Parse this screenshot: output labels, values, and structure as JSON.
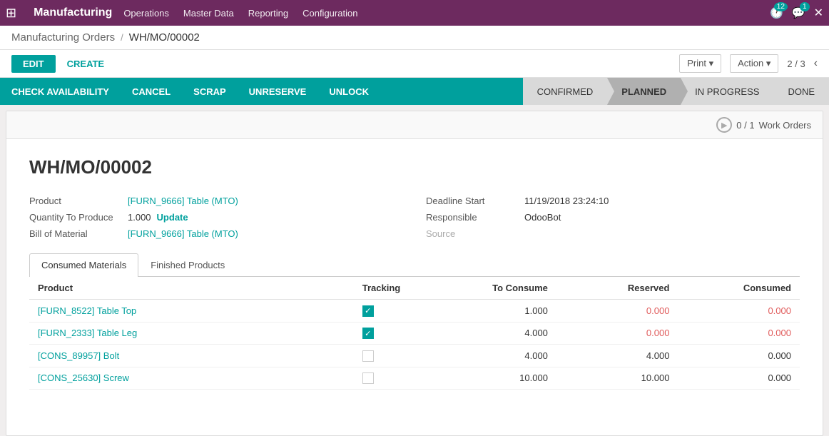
{
  "navbar": {
    "app_name": "Manufacturing",
    "menu_items": [
      "Operations",
      "Master Data",
      "Reporting",
      "Configuration"
    ],
    "notifications": {
      "calendar": "12",
      "chat": "1"
    }
  },
  "breadcrumb": {
    "parent": "Manufacturing Orders",
    "separator": "/",
    "current": "WH/MO/00002"
  },
  "action_bar": {
    "edit_label": "EDIT",
    "create_label": "CREATE",
    "print_label": "Print",
    "action_label": "Action",
    "pager": "2 / 3"
  },
  "status_bar": {
    "check_availability": "CHECK AVAILABILITY",
    "cancel": "CANCEL",
    "scrap": "SCRAP",
    "unreserve": "UNRESERVE",
    "unlock": "UNLOCK",
    "stages": [
      {
        "label": "CONFIRMED",
        "active": false
      },
      {
        "label": "PLANNED",
        "active": true
      },
      {
        "label": "IN PROGRESS",
        "active": false
      },
      {
        "label": "DONE",
        "active": false
      }
    ]
  },
  "work_orders": {
    "count": "0 / 1",
    "label": "Work Orders"
  },
  "form": {
    "title": "WH/MO/00002",
    "product_label": "Product",
    "product_value": "[FURN_9666] Table (MTO)",
    "quantity_label": "Quantity To Produce",
    "quantity_value": "1.000",
    "update_label": "Update",
    "bom_label": "Bill of Material",
    "bom_value": "[FURN_9666] Table (MTO)",
    "deadline_label": "Deadline Start",
    "deadline_value": "11/19/2018 23:24:10",
    "responsible_label": "Responsible",
    "responsible_value": "OdooBot",
    "source_label": "Source"
  },
  "tabs": [
    {
      "label": "Consumed Materials",
      "active": true
    },
    {
      "label": "Finished Products",
      "active": false
    }
  ],
  "table": {
    "headers": [
      "Product",
      "Tracking",
      "To Consume",
      "Reserved",
      "Consumed"
    ],
    "rows": [
      {
        "product": "[FURN_8522] Table Top",
        "tracking": "checked",
        "to_consume": "1.000",
        "reserved": "0.000",
        "consumed": "0.000",
        "reserved_red": true,
        "consumed_red": true
      },
      {
        "product": "[FURN_2333] Table Leg",
        "tracking": "checked",
        "to_consume": "4.000",
        "reserved": "0.000",
        "consumed": "0.000",
        "reserved_red": true,
        "consumed_red": true
      },
      {
        "product": "[CONS_89957] Bolt",
        "tracking": "unchecked",
        "to_consume": "4.000",
        "reserved": "4.000",
        "consumed": "0.000",
        "reserved_red": false,
        "consumed_red": false
      },
      {
        "product": "[CONS_25630] Screw",
        "tracking": "unchecked",
        "to_consume": "10.000",
        "reserved": "10.000",
        "consumed": "0.000",
        "reserved_red": false,
        "consumed_red": false
      }
    ]
  }
}
